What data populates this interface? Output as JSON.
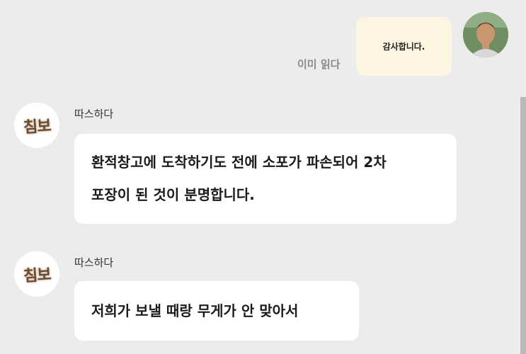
{
  "outgoing": {
    "read_status": "이미 읽다",
    "message": "감사합니다."
  },
  "messages": [
    {
      "sender": "따스하다",
      "avatar_text": "침보",
      "text": "환적창고에 도착하기도 전에 소포가 파손되어 2차\n포장이 된 것이 분명합니다."
    },
    {
      "sender": "따스하다",
      "avatar_text": "침보",
      "text": "저희가 보낼 때랑 무게가 안 맞아서"
    }
  ],
  "colors": {
    "background": "#ececec",
    "outgoing_bubble": "#fdf5e2",
    "incoming_bubble": "#ffffff",
    "read_status": "#8b8b8b"
  }
}
